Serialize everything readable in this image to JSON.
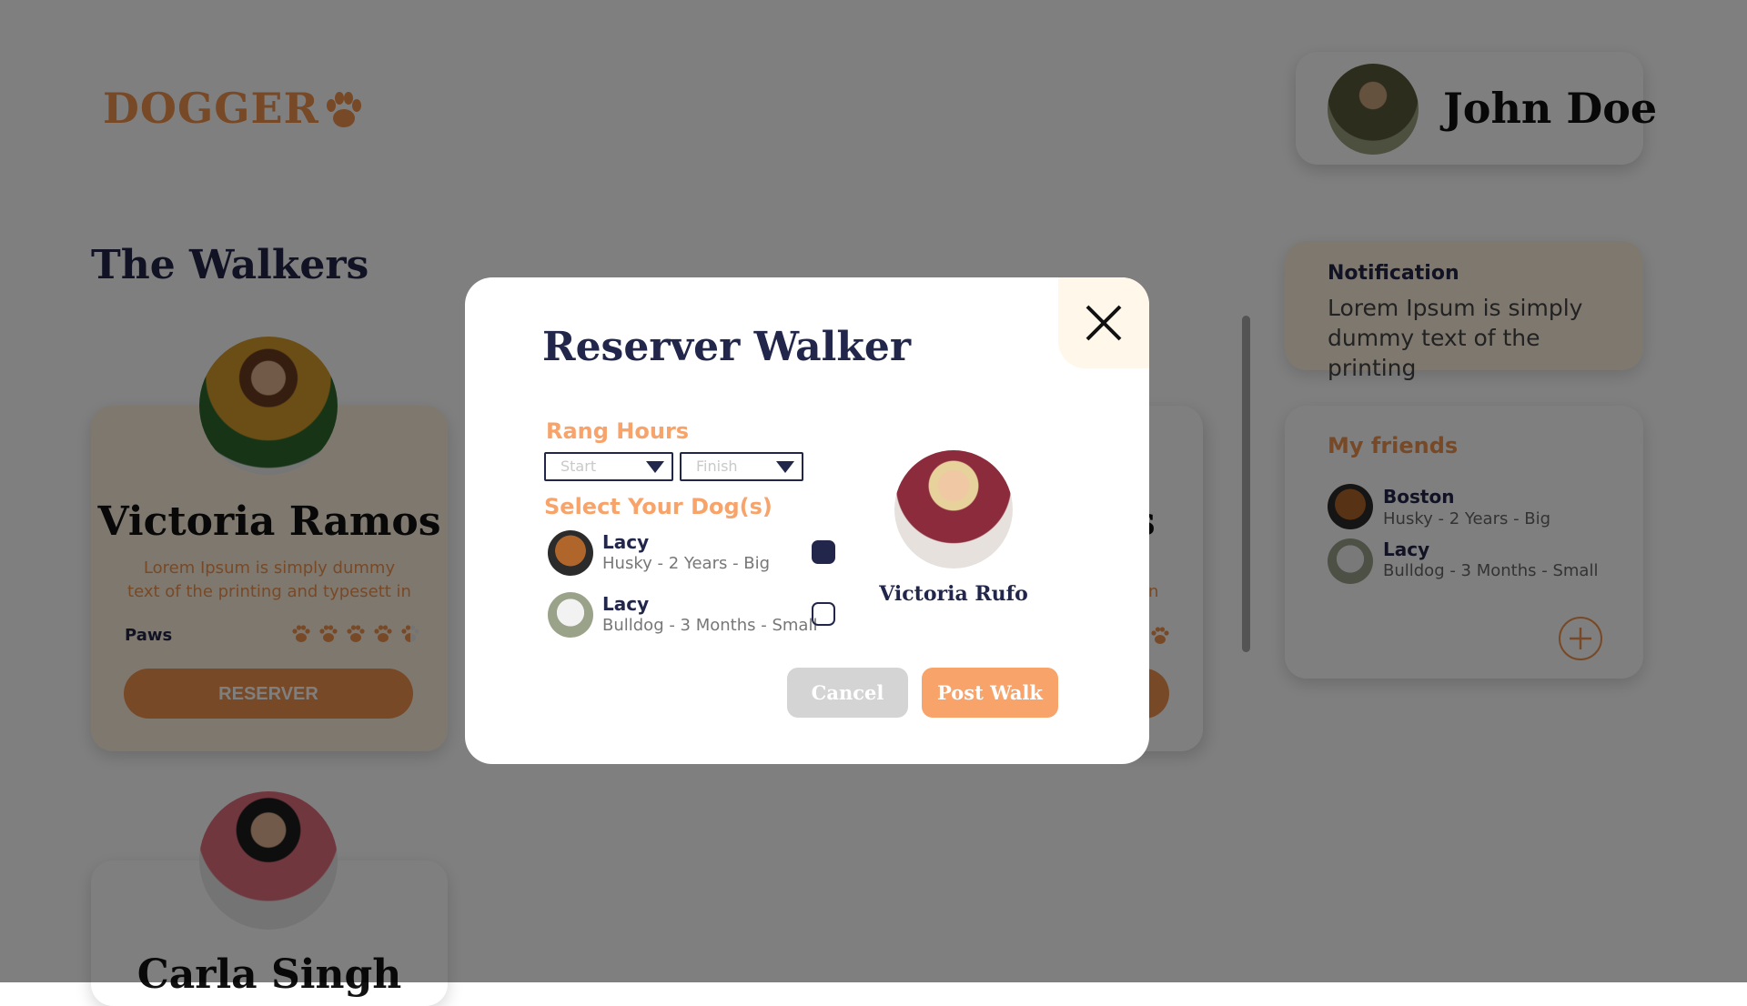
{
  "app": {
    "logo": "DOGGER",
    "logo_icon": "paw-icon"
  },
  "user": {
    "name": "John Doe"
  },
  "page": {
    "section_title": "The Walkers"
  },
  "walkers": [
    {
      "name": "Victoria Ramos",
      "description": "Lorem Ipsum is simply dummy text of the printing and typesett in",
      "paws_label": "Paws",
      "rating": 4.5,
      "rating_max": 5,
      "button": "RESERVER"
    },
    {
      "name_visible_fragment": "s",
      "description_fragment": "n"
    },
    {
      "name": "Carla Singh"
    }
  ],
  "notification": {
    "title": "Notification",
    "text": "Lorem Ipsum is simply dummy text of the printing"
  },
  "friends": {
    "title": "My friends",
    "items": [
      {
        "name": "Boston",
        "meta": "Husky - 2 Years - Big"
      },
      {
        "name": "Lacy",
        "meta": "Bulldog - 3 Months - Small"
      }
    ],
    "add_icon": "plus-icon"
  },
  "modal": {
    "title": "Reserver Walker",
    "close_icon": "close-icon",
    "rang_hours_label": "Rang Hours",
    "start_placeholder": "Start",
    "finish_placeholder": "Finish",
    "select_dogs_label": "Select Your Dog(s)",
    "dogs": [
      {
        "name": "Lacy",
        "meta": "Husky - 2 Years - Big",
        "checked": true
      },
      {
        "name": "Lacy",
        "meta": "Bulldog - 3 Months - Small",
        "checked": false
      }
    ],
    "walker_name": "Victoria Rufo",
    "cancel_label": "Cancel",
    "post_label": "Post Walk"
  },
  "colors": {
    "accent_orange": "#f1924c",
    "light_orange": "#f7a36a",
    "navy": "#22264b",
    "cream": "#fff1df",
    "overlay": "rgba(0,0,0,0.5)"
  }
}
